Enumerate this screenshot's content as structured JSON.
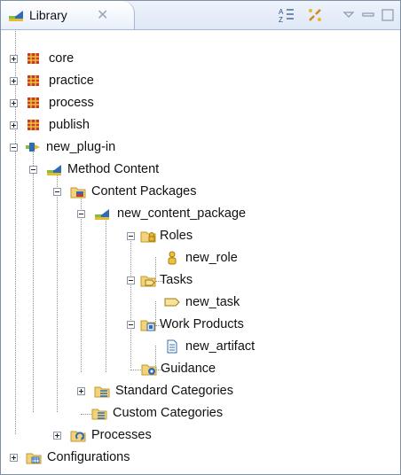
{
  "view": {
    "title": "Library",
    "close_glyph": "✕",
    "toolbar": [
      "sort-icon",
      "link-icon",
      "view-menu-icon",
      "minimize-icon",
      "maximize-icon"
    ]
  },
  "tree": [
    {
      "label": "core",
      "icon": "package-icon",
      "expander": "plus"
    },
    {
      "label": "practice",
      "icon": "package-icon",
      "expander": "plus"
    },
    {
      "label": "process",
      "icon": "package-icon",
      "expander": "plus"
    },
    {
      "label": "publish",
      "icon": "package-icon",
      "expander": "plus"
    },
    {
      "label": "new_plug-in",
      "icon": "plugin-icon",
      "expander": "minus"
    },
    {
      "label": "Method Content",
      "icon": "method-content-icon",
      "expander": "minus"
    },
    {
      "label": "Content Packages",
      "icon": "content-packages-icon",
      "expander": "minus"
    },
    {
      "label": "new_content_package",
      "icon": "content-package-icon",
      "expander": "minus"
    },
    {
      "label": "Roles",
      "icon": "roles-folder-icon",
      "expander": "minus"
    },
    {
      "label": "new_role",
      "icon": "role-icon",
      "expander": "none"
    },
    {
      "label": "Tasks",
      "icon": "tasks-folder-icon",
      "expander": "minus"
    },
    {
      "label": "new_task",
      "icon": "task-icon",
      "expander": "none"
    },
    {
      "label": "Work Products",
      "icon": "work-products-folder-icon",
      "expander": "minus"
    },
    {
      "label": "new_artifact",
      "icon": "artifact-icon",
      "expander": "none"
    },
    {
      "label": "Guidance",
      "icon": "guidance-folder-icon",
      "expander": "none"
    },
    {
      "label": "Standard Categories",
      "icon": "standard-categories-icon",
      "expander": "plus"
    },
    {
      "label": "Custom Categories",
      "icon": "custom-categories-icon",
      "expander": "none"
    },
    {
      "label": "Processes",
      "icon": "processes-icon",
      "expander": "plus"
    },
    {
      "label": "Configurations",
      "icon": "configurations-icon",
      "expander": "plus"
    }
  ]
}
